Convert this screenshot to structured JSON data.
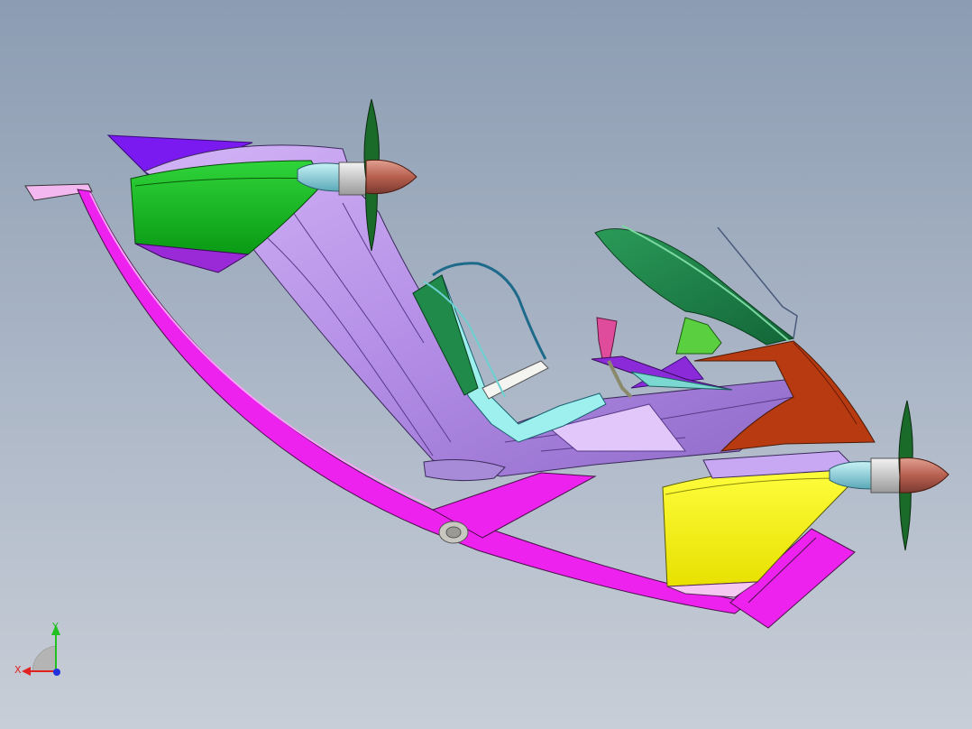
{
  "viewport": {
    "background_top": "#8c9cb2",
    "background_bottom": "#c8ced7"
  },
  "model": {
    "parts": [
      {
        "name": "left-front-nacelle",
        "color": "#12c01a"
      },
      {
        "name": "right-front-nacelle",
        "color": "#f5f50a"
      },
      {
        "name": "main-wing-frame",
        "color": "#b48ee6"
      },
      {
        "name": "landing-skid",
        "color": "#ee22ee"
      },
      {
        "name": "rear-tail-fin",
        "color": "#1a8040"
      },
      {
        "name": "rear-cowling",
        "color": "#b83a10"
      },
      {
        "name": "propeller-spinner",
        "color": "#b85a50"
      },
      {
        "name": "pilot-seat",
        "color": "#9ef0ee"
      }
    ]
  },
  "triad": {
    "x_label": "X",
    "y_label": "Y",
    "x_color": "#e22222",
    "y_color": "#22c022",
    "z_color": "#2233dd"
  }
}
